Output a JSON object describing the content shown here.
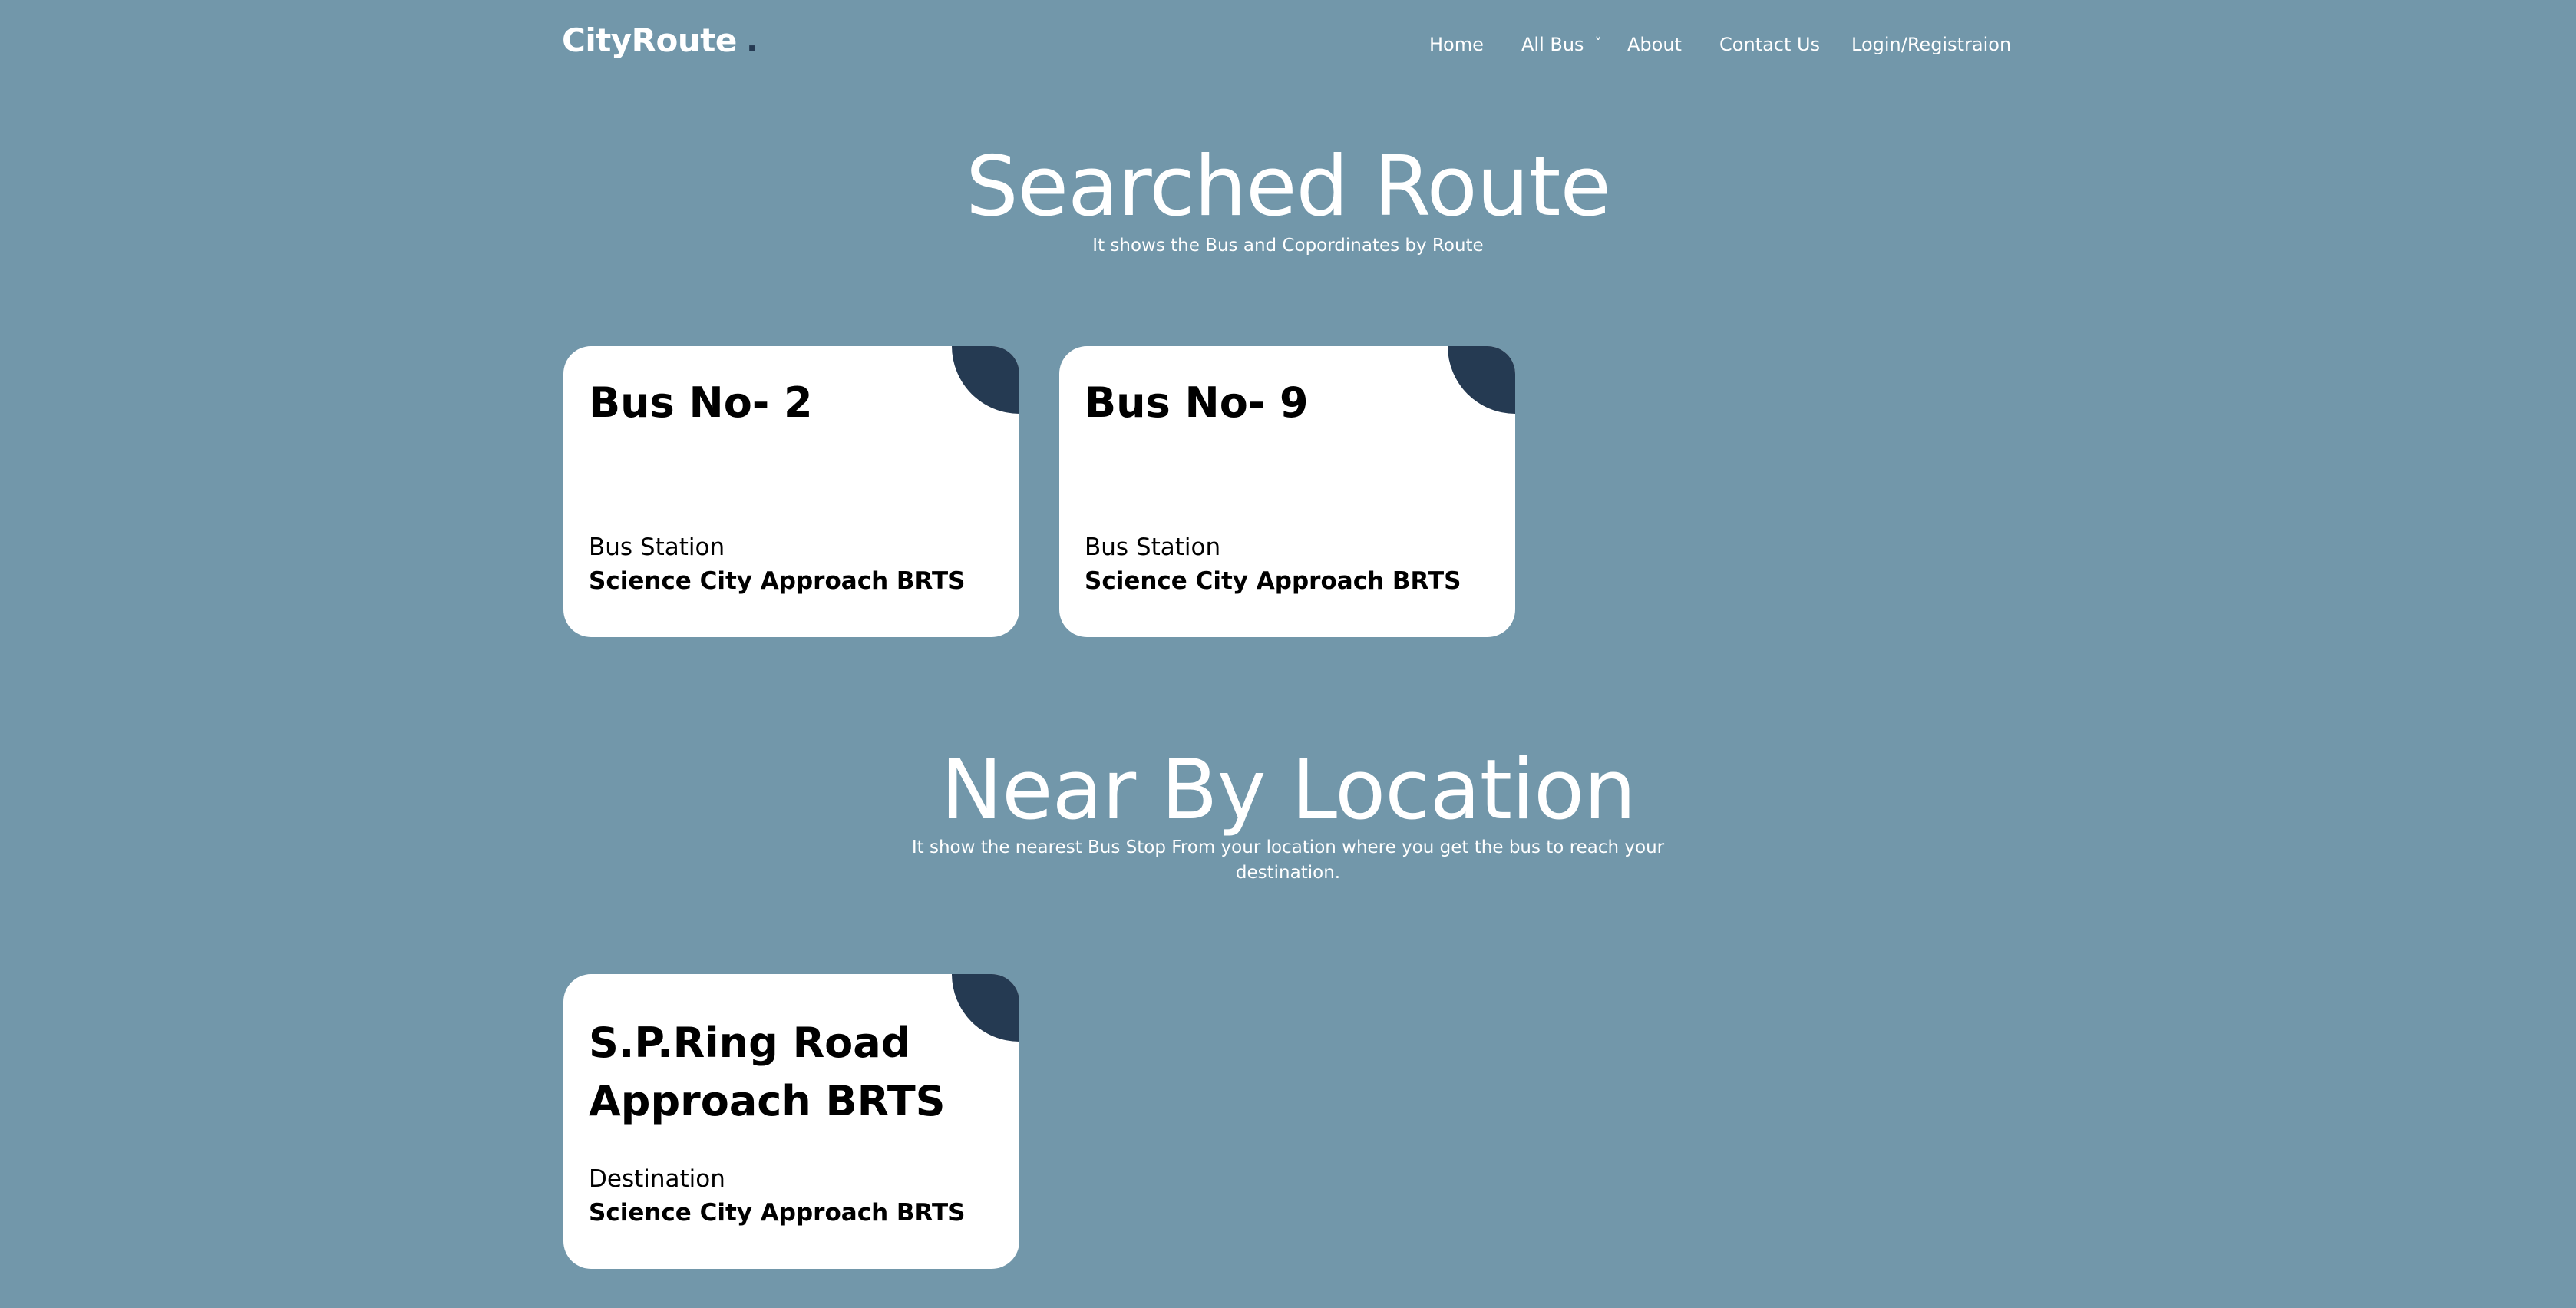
{
  "brand": {
    "name": "CityRoute",
    "dot": "."
  },
  "nav": {
    "items": [
      {
        "label": "Home"
      },
      {
        "label": "All Bus"
      },
      {
        "label": "About"
      },
      {
        "label": "Contact Us"
      },
      {
        "label": "Login/Registraion"
      }
    ],
    "dropdown_icon": "chevron-down-icon"
  },
  "searched_route": {
    "title": "Searched Route",
    "subtitle": "It shows the Bus and Copordinates by Route",
    "cards": [
      {
        "title": "Bus No- 2",
        "label": "Bus Station",
        "value": "Science City Approach BRTS"
      },
      {
        "title": "Bus No- 9",
        "label": "Bus Station",
        "value": "Science City Approach BRTS"
      }
    ]
  },
  "near_by": {
    "title": "Near By Location",
    "subtitle_line1": "It show the nearest Bus Stop From your location where you get the bus to reach your",
    "subtitle_line2": "destination.",
    "cards": [
      {
        "title_line1": "S.P.Ring Road",
        "title_line2": "Approach BRTS",
        "label": "Destination",
        "value": "Science City Approach BRTS"
      }
    ]
  },
  "colors": {
    "background": "#7297aa",
    "accent": "#253a52",
    "card": "#ffffff"
  }
}
